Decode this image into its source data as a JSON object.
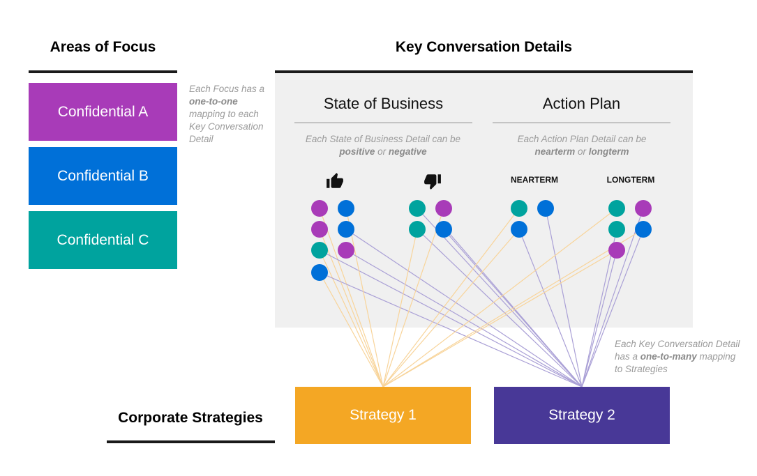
{
  "colors": {
    "confidential_a": "#a83bb8",
    "confidential_b": "#0070d8",
    "confidential_c": "#00a39e",
    "strategy_1": "#f4a724",
    "strategy_2": "#483897",
    "line_strategy_1": "#f8d49a",
    "line_strategy_2": "#aaa0d6"
  },
  "areas_of_focus": {
    "title": "Areas of Focus",
    "items": [
      {
        "label": "Confidential A",
        "key": "a"
      },
      {
        "label": "Confidential B",
        "key": "b"
      },
      {
        "label": "Confidential C",
        "key": "c"
      }
    ],
    "note_parts": [
      "Each Focus has a ",
      "one-to-one",
      " mapping to each Key Conversation Detail"
    ]
  },
  "key_conversation_details": {
    "title": "Key Conversation Details",
    "state_of_business": {
      "title": "State of Business",
      "note_line1": "Each State of Business Detail can be",
      "note_bold1": "positive",
      "note_or": " or ",
      "note_bold2": "negative",
      "positive_icon": "thumbs-up-icon",
      "negative_icon": "thumbs-down-icon"
    },
    "action_plan": {
      "title": "Action Plan",
      "note_line1": "Each Action Plan Detail can be",
      "note_bold1": "nearterm",
      "note_or": " or ",
      "note_bold2": "longterm",
      "nearterm_label": "NEARTERM",
      "longterm_label": "LONGTERM"
    }
  },
  "details": [
    {
      "group": "positive",
      "col": 0,
      "row": 0,
      "focus": "a",
      "strategies": [
        1
      ]
    },
    {
      "group": "positive",
      "col": 0,
      "row": 1,
      "focus": "a",
      "strategies": [
        1
      ]
    },
    {
      "group": "positive",
      "col": 0,
      "row": 2,
      "focus": "c",
      "strategies": [
        1,
        2
      ]
    },
    {
      "group": "positive",
      "col": 0,
      "row": 3,
      "focus": "b",
      "strategies": [
        1,
        2
      ]
    },
    {
      "group": "positive",
      "col": 1,
      "row": 0,
      "focus": "b",
      "strategies": [
        1
      ]
    },
    {
      "group": "positive",
      "col": 1,
      "row": 1,
      "focus": "b",
      "strategies": [
        2
      ]
    },
    {
      "group": "positive",
      "col": 1,
      "row": 2,
      "focus": "a",
      "strategies": [
        2
      ]
    },
    {
      "group": "negative",
      "col": 0,
      "row": 0,
      "focus": "c",
      "strategies": [
        2
      ]
    },
    {
      "group": "negative",
      "col": 0,
      "row": 1,
      "focus": "c",
      "strategies": [
        1,
        2
      ]
    },
    {
      "group": "negative",
      "col": 1,
      "row": 0,
      "focus": "a",
      "strategies": [
        1
      ]
    },
    {
      "group": "negative",
      "col": 1,
      "row": 1,
      "focus": "b",
      "strategies": [
        2,
        2
      ]
    },
    {
      "group": "nearterm",
      "col": 0,
      "row": 0,
      "focus": "c",
      "strategies": [
        1
      ]
    },
    {
      "group": "nearterm",
      "col": 0,
      "row": 1,
      "focus": "b",
      "strategies": [
        1,
        2
      ]
    },
    {
      "group": "nearterm",
      "col": 1,
      "row": 0,
      "focus": "b",
      "strategies": [
        2
      ]
    },
    {
      "group": "longterm",
      "col": 0,
      "row": 0,
      "focus": "c",
      "strategies": [
        1
      ]
    },
    {
      "group": "longterm",
      "col": 0,
      "row": 1,
      "focus": "c",
      "strategies": [
        2
      ]
    },
    {
      "group": "longterm",
      "col": 0,
      "row": 2,
      "focus": "a",
      "strategies": [
        1,
        2
      ]
    },
    {
      "group": "longterm",
      "col": 1,
      "row": 0,
      "focus": "a",
      "strategies": [
        2
      ]
    },
    {
      "group": "longterm",
      "col": 1,
      "row": 1,
      "focus": "b",
      "strategies": [
        1,
        2
      ]
    }
  ],
  "corporate_strategies": {
    "title": "Corporate Strategies",
    "items": [
      {
        "label": "Strategy 1",
        "id": 1
      },
      {
        "label": "Strategy 2",
        "id": 2
      }
    ],
    "note_parts": [
      "Each Key Conversation Detail has a ",
      "one-to-many",
      " mapping to Strategies"
    ]
  }
}
